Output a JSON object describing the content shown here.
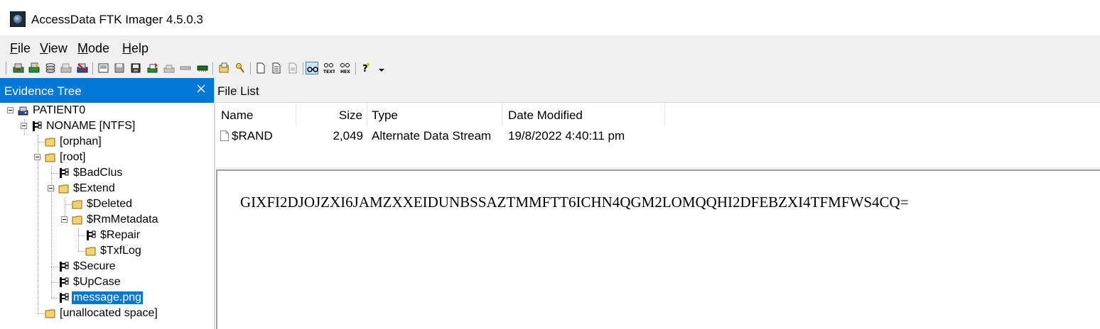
{
  "window": {
    "title": "AccessData FTK Imager 4.5.0.3"
  },
  "menu": [
    {
      "mnemonic": "F",
      "rest": "ile"
    },
    {
      "mnemonic": "V",
      "rest": "iew"
    },
    {
      "mnemonic": "M",
      "rest": "ode"
    },
    {
      "mnemonic": "H",
      "rest": "elp"
    }
  ],
  "evidence_tree": {
    "title": "Evidence Tree",
    "items": [
      {
        "label": "PATIENT0"
      },
      {
        "label": "NONAME [NTFS]"
      },
      {
        "label": "[orphan]"
      },
      {
        "label": "[root]"
      },
      {
        "label": "$BadClus"
      },
      {
        "label": "$Extend"
      },
      {
        "label": "$Deleted"
      },
      {
        "label": "$RmMetadata"
      },
      {
        "label": "$Repair"
      },
      {
        "label": "$TxfLog"
      },
      {
        "label": "$Secure"
      },
      {
        "label": "$UpCase"
      },
      {
        "label": "message.png",
        "selected": true
      },
      {
        "label": "[unallocated space]"
      }
    ]
  },
  "file_list": {
    "title": "File List",
    "columns": [
      "Name",
      "Size",
      "Type",
      "Date Modified"
    ],
    "rows": [
      {
        "name": "$RAND",
        "size": "2,049",
        "type": "Alternate Data Stream",
        "date": "19/8/2022 4:40:11 pm"
      }
    ]
  },
  "viewer": {
    "content": "GIXFI2DJOJZXI6JAMZXXEIDUNBSSAZTMMFTT6ICHN4QGM2LOMQQHI2DFEBZXI4TFMFWS4CQ="
  },
  "colors": {
    "selection": "#0078d7",
    "folder": "#f5d36b",
    "toolbar_bg": "#f0f0f0"
  }
}
